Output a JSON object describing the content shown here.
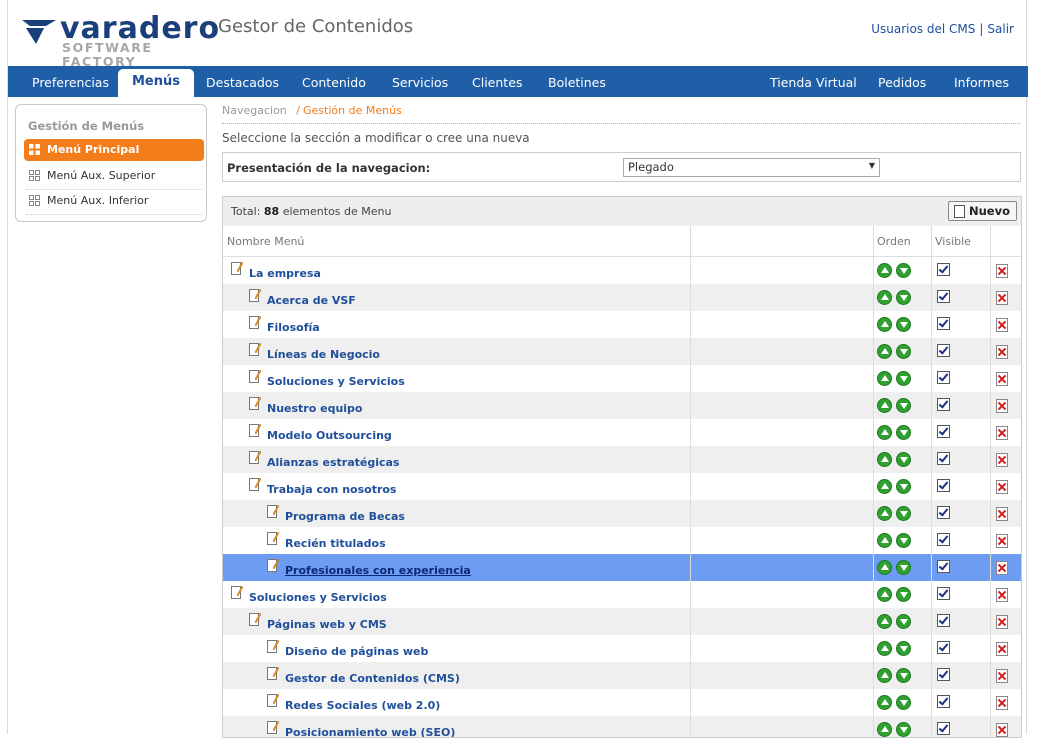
{
  "brand": {
    "logo_word": "varadero",
    "logo_sub": "SOFTWARE FACTORY",
    "app_title": "Gestor de Contenidos",
    "accent_blue": "#1f5fa8",
    "accent_orange": "#f27d1a"
  },
  "user_links": {
    "users": "Usuarios del CMS",
    "separator": "|",
    "logout": "Salir"
  },
  "nav": {
    "tabs": [
      {
        "label": "Preferencias"
      },
      {
        "label": "Menús",
        "active": true
      },
      {
        "label": "Destacados"
      },
      {
        "label": "Contenido"
      },
      {
        "label": "Servicios"
      },
      {
        "label": "Clientes"
      },
      {
        "label": "Boletines"
      },
      {
        "label": "Tienda Virtual"
      },
      {
        "label": "Pedidos"
      },
      {
        "label": "Informes"
      }
    ]
  },
  "sidebar": {
    "title": "Gestión de Menús",
    "items": [
      {
        "label": "Menú Principal",
        "active": true,
        "icon": "grid-icon"
      },
      {
        "label": "Menú Aux. Superior",
        "icon": "grid-icon"
      },
      {
        "label": "Menú Aux. Inferior",
        "icon": "grid-icon"
      }
    ]
  },
  "breadcrumb": {
    "root": "Navegacion",
    "sep": "/",
    "current": "Gestión de Menús"
  },
  "instruction": "Seleccione la sección a modificar o cree una nueva",
  "presentation": {
    "label": "Presentación de la navegacion:",
    "selected": "Plegado"
  },
  "table": {
    "total_prefix": "Total:",
    "total_count": "88",
    "total_suffix": "elementos de Menu",
    "new_button": "Nuevo",
    "headers": {
      "name": "Nombre Menú",
      "order": "Orden",
      "visible": "Visible"
    },
    "rows": [
      {
        "name": "La empresa",
        "level": 0
      },
      {
        "name": "Acerca de VSF",
        "level": 1
      },
      {
        "name": "Filosofía",
        "level": 1
      },
      {
        "name": "Líneas de Negocio",
        "level": 1
      },
      {
        "name": "Soluciones y Servicios",
        "level": 1
      },
      {
        "name": "Nuestro equipo",
        "level": 1
      },
      {
        "name": "Modelo Outsourcing",
        "level": 1
      },
      {
        "name": "Alianzas estratégicas",
        "level": 1
      },
      {
        "name": "Trabaja con nosotros",
        "level": 1
      },
      {
        "name": "Programa de Becas",
        "level": 2
      },
      {
        "name": "Recién titulados",
        "level": 2
      },
      {
        "name": "Profesionales con experiencia",
        "level": 2,
        "selected": true
      },
      {
        "name": "Soluciones y Servicios",
        "level": 0
      },
      {
        "name": "Páginas web y CMS",
        "level": 1
      },
      {
        "name": "Diseño de páginas web",
        "level": 2
      },
      {
        "name": "Gestor de Contenidos (CMS)",
        "level": 2
      },
      {
        "name": "Redes Sociales (web 2.0)",
        "level": 2
      },
      {
        "name": "Posicionamiento web (SEO)",
        "level": 2
      }
    ]
  }
}
